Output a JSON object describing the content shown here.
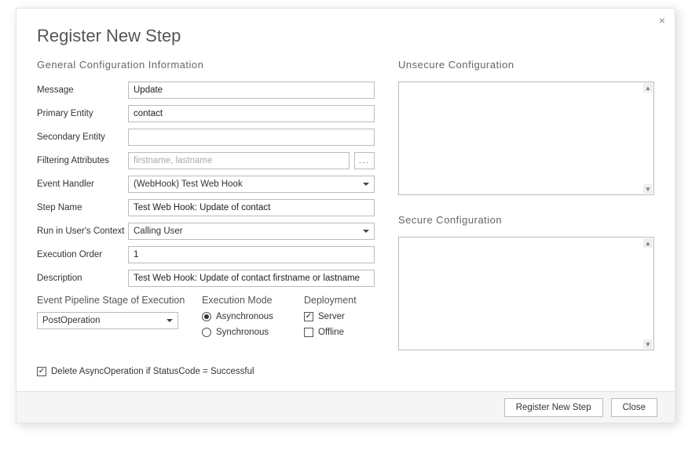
{
  "title": "Register New Step",
  "left_header": "General Configuration Information",
  "labels": {
    "message": "Message",
    "primary_entity": "Primary Entity",
    "secondary_entity": "Secondary Entity",
    "filtering_attributes": "Filtering Attributes",
    "event_handler": "Event Handler",
    "step_name": "Step Name",
    "run_context": "Run in User's Context",
    "execution_order": "Execution Order",
    "description": "Description"
  },
  "values": {
    "message": "Update",
    "primary_entity": "contact",
    "secondary_entity": "",
    "filtering_placeholder": "firstname, lastname",
    "event_handler": "(WebHook) Test Web Hook",
    "step_name": "Test Web Hook: Update of contact",
    "run_context": "Calling User",
    "execution_order": "1",
    "description": "Test Web Hook: Update of contact firstname or lastname"
  },
  "pipeline": {
    "header": "Event Pipeline Stage of Execution",
    "value": "PostOperation"
  },
  "exec_mode": {
    "header": "Execution Mode",
    "opt1": "Asynchronous",
    "opt2": "Synchronous"
  },
  "deployment": {
    "header": "Deployment",
    "opt1": "Server",
    "opt2": "Offline"
  },
  "delete_async": "Delete AsyncOperation if StatusCode = Successful",
  "right": {
    "unsecure_header": "Unsecure  Configuration",
    "secure_header": "Secure  Configuration"
  },
  "buttons": {
    "register": "Register New Step",
    "close": "Close"
  },
  "ellipsis": "..."
}
